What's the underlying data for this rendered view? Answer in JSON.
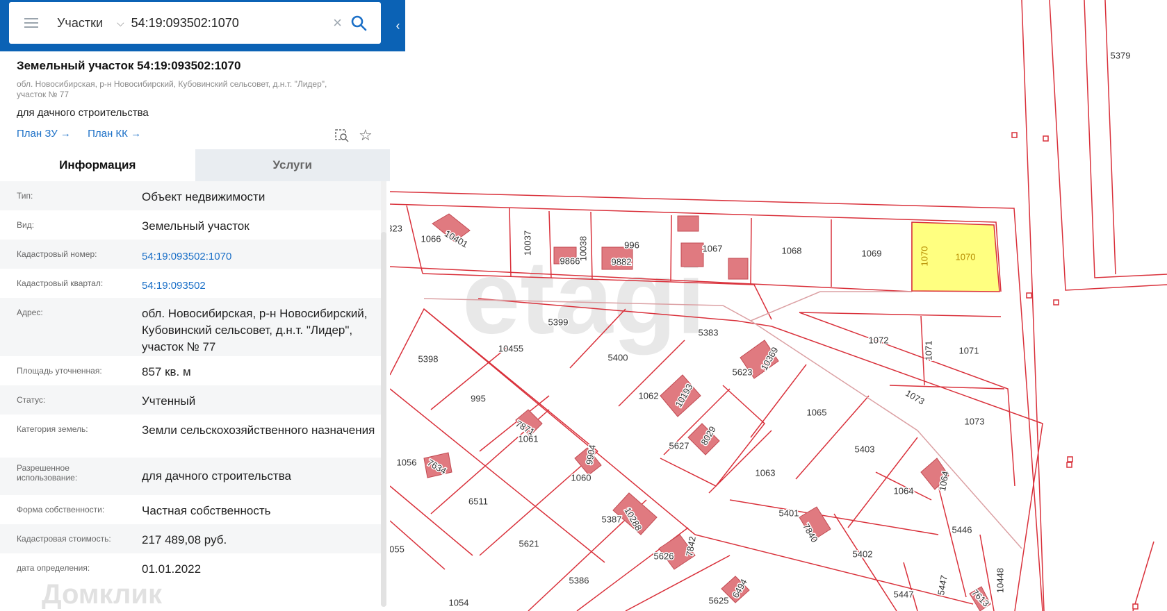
{
  "search": {
    "layer": "Участки",
    "query": "54:19:093502:1070"
  },
  "card": {
    "title": "Земельный участок 54:19:093502:1070",
    "address": "обл. Новосибирская, р-н Новосибирский, Кубовинский сельсовет, д.н.т. \"Лидер\", участок № 77",
    "permitted_use": "для дачного строительства",
    "link_plan_zu": "План ЗУ →",
    "link_plan_kk": "План КК →"
  },
  "tabs": {
    "info": "Информация",
    "services": "Услуги"
  },
  "info_rows": [
    {
      "key": "Тип:",
      "value": "Объект недвижимости"
    },
    {
      "key": "Вид:",
      "value": "Земельный участок"
    },
    {
      "key": "Кадастровый номер:",
      "value": "54:19:093502:1070"
    },
    {
      "key": "Кадастровый квартал:",
      "value": "54:19:093502"
    },
    {
      "key": "Адрес:",
      "value": "обл. Новосибирская, р-н Новосибирский, Кубовинский сельсовет, д.н.т. \"Лидер\", участок № 77"
    },
    {
      "key": "Площадь уточненная:",
      "value": "857 кв. м"
    },
    {
      "key": "Статус:",
      "value": "Учтенный"
    },
    {
      "key": "Категория земель:",
      "value": "Земли сельскохозяйственного назначения"
    },
    {
      "key": "Разрешенное использование:",
      "value": "для дачного строительства"
    },
    {
      "key": "Форма собственности:",
      "value": "Частная собственность"
    },
    {
      "key": "Кадастровая стоимость:",
      "value": "217 489,08 руб."
    },
    {
      "key": "дата определения:",
      "value": "01.01.2022"
    }
  ],
  "map": {
    "watermark": "etagi",
    "parcel_labels": [
      "5379",
      "1066",
      "10401",
      "10037",
      "9866",
      "10038",
      "996",
      "9882",
      "1067",
      "1068",
      "1069",
      "1070",
      "1070",
      "5399",
      "5383",
      "10455",
      "5398",
      "5400",
      "10369",
      "5623",
      "1072",
      "1071",
      "1071",
      "1073",
      "1073",
      "995",
      "1062",
      "10193",
      "1065",
      "5627",
      "8029",
      "7871",
      "1061",
      "1056",
      "7634",
      "9904",
      "1060",
      "5403",
      "1063",
      "6511",
      "5387",
      "10288",
      "1064",
      "1064",
      "5401",
      "7840",
      "5446",
      "5621",
      "5626",
      "7842",
      "5402",
      "5386",
      "5625",
      "6494",
      "5447",
      "5447",
      "10448",
      "7613",
      "1054",
      "055",
      "323"
    ],
    "colors": {
      "boundary": "#d9303a",
      "building": "#e07a80",
      "selected": "#ffff80"
    }
  },
  "footer_watermark": "Домклик"
}
